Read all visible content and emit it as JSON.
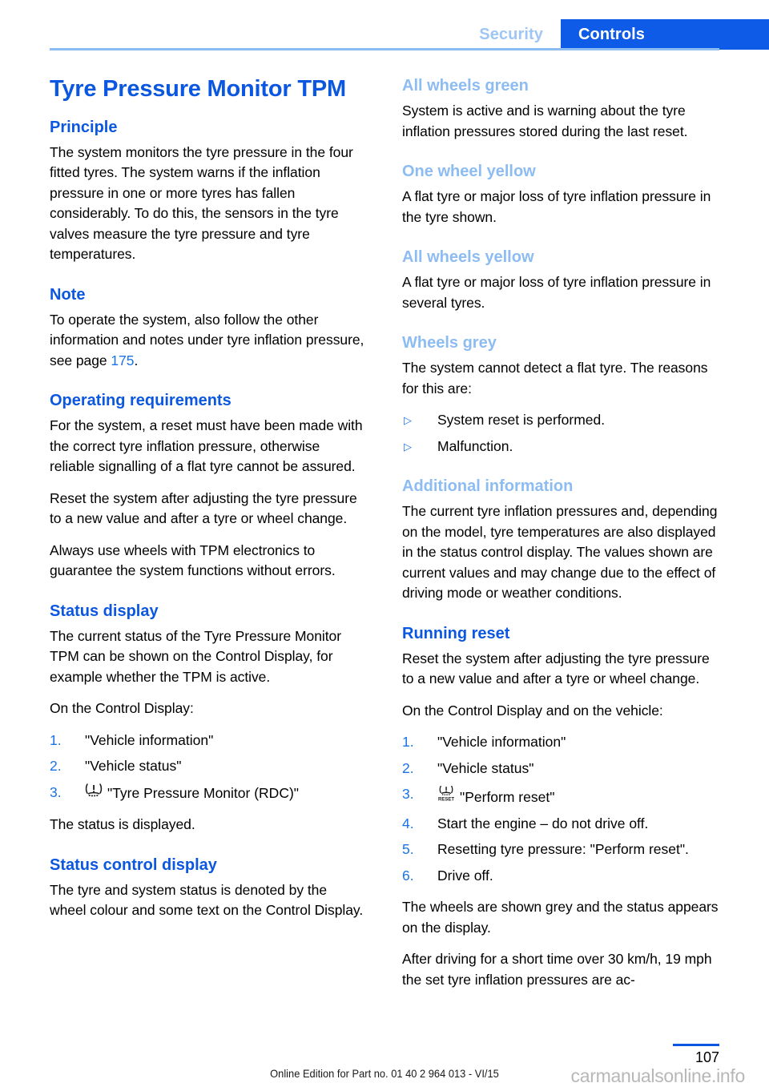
{
  "header": {
    "inactive_tab": "Security",
    "active_tab": "Controls",
    "accent_blue": "#0d5be6",
    "light_blue": "#8cbcf2"
  },
  "left_column": {
    "doc_title": "Tyre Pressure Monitor TPM",
    "principle": {
      "heading": "Principle",
      "paragraph": "The system monitors the tyre pressure in the four fitted tyres. The system warns if the inflation pressure in one or more tyres has fallen considerably. To do this, the sensors in the tyre valves measure the tyre pressure and tyre temperatures."
    },
    "note": {
      "heading": "Note",
      "text_before": "To operate the system, also follow the other information and notes under tyre inflation pressure, see page ",
      "page_ref": "175",
      "text_after": "."
    },
    "operating_requirements": {
      "heading": "Operating requirements",
      "paragraph_1": "For the system, a reset must have been made with the correct tyre inflation pressure, otherwise reliable signalling of a flat tyre cannot be assured.",
      "paragraph_2": "Reset the system after adjusting the tyre pressure to a new value and after a tyre or wheel change.",
      "paragraph_3": "Always use wheels with TPM electronics to guarantee the system functions without errors."
    },
    "status_display": {
      "heading": "Status display",
      "paragraph_1": "The current status of the Tyre Pressure Monitor TPM can be shown on the Control Display, for example whether the TPM is active.",
      "paragraph_2": "On the Control Display:",
      "steps": [
        {
          "num": "1.",
          "label": "\"Vehicle information\"",
          "icon": null
        },
        {
          "num": "2.",
          "label": "\"Vehicle status\"",
          "icon": null
        },
        {
          "num": "3.",
          "label": "\"Tyre Pressure Monitor (RDC)\"",
          "icon": "tpms-warning-icon"
        }
      ],
      "paragraph_3": "The status is displayed."
    },
    "status_control_display": {
      "heading": "Status control display",
      "paragraph": "The tyre and system status is denoted by the wheel colour and some text on the Control Display."
    }
  },
  "right_column": {
    "all_wheels_green": {
      "heading": "All wheels green",
      "paragraph": "System is active and is warning about the tyre inflation pressures stored during the last reset."
    },
    "one_wheel_yellow": {
      "heading": "One wheel yellow",
      "paragraph": "A flat tyre or major loss of tyre inflation pressure in the tyre shown."
    },
    "all_wheels_yellow": {
      "heading": "All wheels yellow",
      "paragraph": "A flat tyre or major loss of tyre inflation pressure in several tyres."
    },
    "wheels_grey": {
      "heading": "Wheels grey",
      "paragraph": "The system cannot detect a flat tyre. The reasons for this are:",
      "bullets": [
        "System reset is performed.",
        "Malfunction."
      ]
    },
    "additional_information": {
      "heading": "Additional information",
      "paragraph": "The current tyre inflation pressures and, depending on the model, tyre temperatures are also displayed in the status control display. The values shown are current values and may change due to the effect of driving mode or weather conditions."
    },
    "running_reset": {
      "heading": "Running reset",
      "paragraph_1": "Reset the system after adjusting the tyre pressure to a new value and after a tyre or wheel change.",
      "paragraph_2": "On the Control Display and on the vehicle:",
      "steps": [
        {
          "num": "1.",
          "label": "\"Vehicle information\"",
          "icon": null
        },
        {
          "num": "2.",
          "label": "\"Vehicle status\"",
          "icon": null
        },
        {
          "num": "3.",
          "label": "\"Perform reset\"",
          "icon": "tpms-reset-icon"
        },
        {
          "num": "4.",
          "label": "Start the engine – do not drive off.",
          "icon": null
        },
        {
          "num": "5.",
          "label": "Resetting tyre pressure: \"Perform reset\".",
          "icon": null
        },
        {
          "num": "6.",
          "label": "Drive off.",
          "icon": null
        }
      ],
      "paragraph_3": "The wheels are shown grey and the status appears on the display.",
      "paragraph_4": "After driving for a short time over 30 km/h, 19 mph the set tyre inflation pressures are ac-"
    }
  },
  "footer": {
    "edition": "Online Edition for Part no. 01 40 2 964 013 - VI/15",
    "page_number": "107",
    "watermark": "carmanualsonline.info"
  }
}
